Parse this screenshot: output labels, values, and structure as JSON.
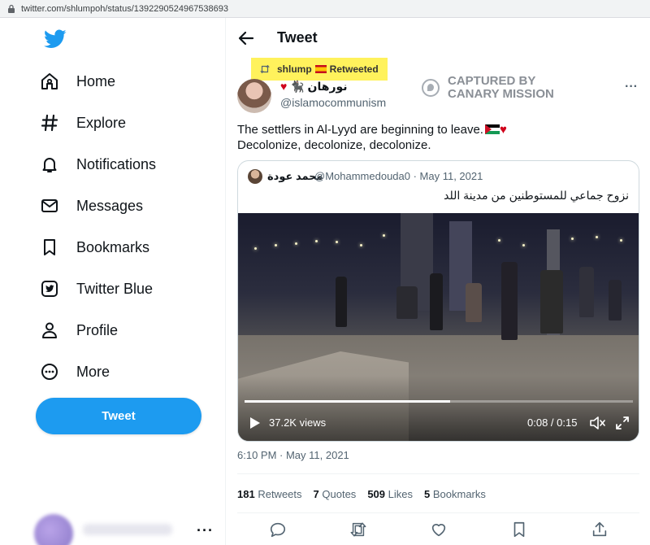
{
  "browser": {
    "url": "twitter.com/shlumpoh/status/1392290524967538693"
  },
  "sidebar": {
    "logo": "twitter-bird-icon",
    "items": [
      {
        "label": "Home",
        "icon": "home-icon"
      },
      {
        "label": "Explore",
        "icon": "hashtag-icon"
      },
      {
        "label": "Notifications",
        "icon": "bell-icon"
      },
      {
        "label": "Messages",
        "icon": "envelope-icon"
      },
      {
        "label": "Bookmarks",
        "icon": "bookmark-icon"
      },
      {
        "label": "Twitter Blue",
        "icon": "twitter-blue-icon"
      },
      {
        "label": "Profile",
        "icon": "person-icon"
      },
      {
        "label": "More",
        "icon": "more-circle-icon"
      }
    ],
    "tweet_button": "Tweet"
  },
  "header": {
    "title": "Tweet"
  },
  "retweet_banner": {
    "user": "shlump",
    "text": "Retweeted"
  },
  "tweet": {
    "author_name": "نورهان",
    "author_handle": "@islamocommunism",
    "watermark": "CAPTURED BY CANARY MISSION",
    "line1": "The settlers in Al-Lyyd are beginning to leave.",
    "line2": "Decolonize, decolonize, decolonize.",
    "timestamp": "6:10 PM · May 11, 2021",
    "stats": {
      "retweets_count": "181",
      "retweets_label": "Retweets",
      "quotes_count": "7",
      "quotes_label": "Quotes",
      "likes_count": "509",
      "likes_label": "Likes",
      "bookmarks_count": "5",
      "bookmarks_label": "Bookmarks"
    }
  },
  "quote": {
    "name": "محمد عودة",
    "handle": "@Mohammedouda0 · May 11, 2021",
    "text": "نزوح جماعي للمستوطنين من مدينة اللد",
    "video": {
      "views": "37.2K views",
      "time": "0:08 / 0:15",
      "progress": 0.53
    }
  },
  "colors": {
    "accent": "#1d9bf0",
    "highlight": "#fff25c",
    "heart": "#d0021b"
  }
}
